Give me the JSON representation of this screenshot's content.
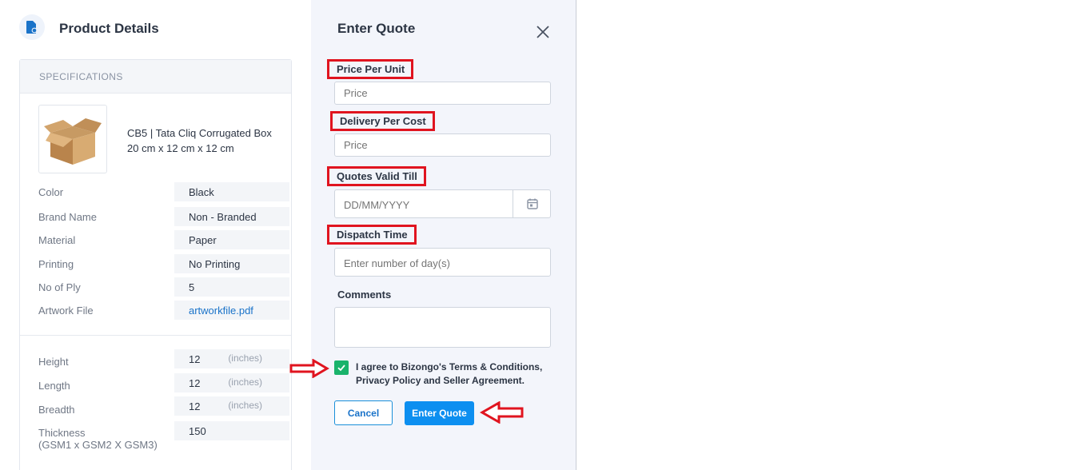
{
  "product_panel": {
    "title": "Product Details",
    "specifications_header": "SPECIFICATIONS",
    "product_name_line1": "CB5 | Tata Cliq Corrugated Box",
    "product_name_line2": "20 cm x 12 cm x 12 cm",
    "attributes": [
      {
        "label": "Color",
        "value": "Black"
      },
      {
        "label": "Brand Name",
        "value": "Non - Branded"
      },
      {
        "label": "Material",
        "value": "Paper"
      },
      {
        "label": "Printing",
        "value": "No Printing"
      },
      {
        "label": "No of Ply",
        "value": "5"
      },
      {
        "label": "Artwork File",
        "value": "artworkfile.pdf"
      }
    ],
    "dimensions": [
      {
        "label": "Height",
        "value": "12",
        "unit": "(inches)"
      },
      {
        "label": "Length",
        "value": "12",
        "unit": "(inches)"
      },
      {
        "label": "Breadth",
        "value": "12",
        "unit": "(inches)"
      }
    ],
    "thickness": {
      "label_line1": "Thickness",
      "label_line2": "(GSM1 x GSM2 X GSM3)",
      "value": "150"
    }
  },
  "quote_panel": {
    "title": "Enter Quote",
    "fields": {
      "price_per_unit": {
        "label": "Price Per Unit",
        "placeholder": "Price"
      },
      "delivery_per_cost": {
        "label": "Delivery Per Cost",
        "placeholder": "Price"
      },
      "quotes_valid_till": {
        "label": "Quotes Valid Till",
        "placeholder": "DD/MM/YYYY"
      },
      "dispatch_time": {
        "label": "Dispatch Time",
        "placeholder": "Enter number of day(s)"
      },
      "comments": {
        "label": "Comments"
      }
    },
    "agreement_line1": "I agree to Bizongo's Terms & Conditions,",
    "agreement_line2": "Privacy Policy and Seller Agreement.",
    "cancel_label": "Cancel",
    "submit_label": "Enter Quote"
  },
  "colors": {
    "highlight": "#e0141f",
    "accent": "#0d8ff0",
    "checkbox": "#19b36b"
  }
}
